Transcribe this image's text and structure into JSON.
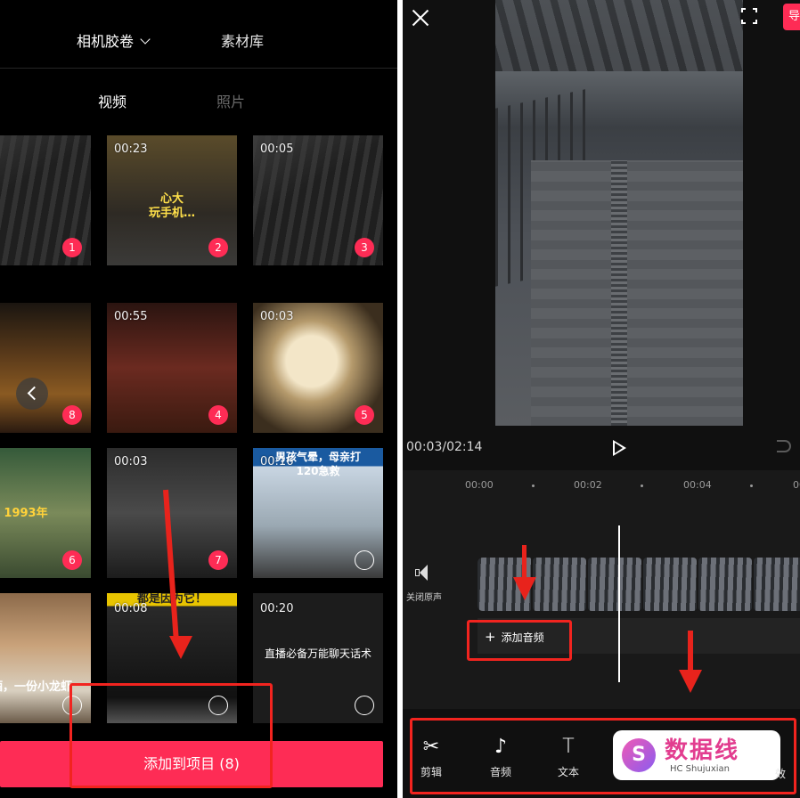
{
  "left": {
    "tabs": {
      "camera_roll": "相机胶卷",
      "library": "素材库"
    },
    "subtabs": {
      "video": "视频",
      "photo": "照片"
    },
    "cells": [
      {
        "duration": "",
        "badge": "1",
        "caption": ""
      },
      {
        "duration": "00:23",
        "badge": "2",
        "caption": "心大\n玩手机…"
      },
      {
        "duration": "00:05",
        "badge": "3",
        "caption": ""
      },
      {
        "duration": "",
        "badge": "8",
        "caption": ""
      },
      {
        "duration": "00:55",
        "badge": "4",
        "caption": ""
      },
      {
        "duration": "00:03",
        "badge": "5",
        "caption": ""
      },
      {
        "duration": "",
        "badge": "6",
        "caption": "1993年"
      },
      {
        "duration": "00:03",
        "badge": "7",
        "caption": ""
      },
      {
        "duration": "00:16",
        "badge": "",
        "caption": "男孩气晕，母亲打\n120急救"
      },
      {
        "duration": "",
        "badge": "",
        "caption": "啤酒，一份小龙虾"
      },
      {
        "duration": "00:08",
        "badge": "",
        "caption": "都是因为它！"
      },
      {
        "duration": "00:20",
        "badge": "",
        "caption": "直播必备万能聊天话术"
      }
    ],
    "add_button": "添加到项目 (8)"
  },
  "right": {
    "timecode": "00:03/02:14",
    "ticks": [
      "00:00",
      "00:02",
      "00:04",
      "00:0"
    ],
    "mute_label": "关闭原声",
    "add_audio": "添加音频",
    "tools": {
      "cut": "剪辑",
      "audio": "音频",
      "text": "文本",
      "more": "效"
    },
    "export_label": "导",
    "watermark": {
      "name": "数据线",
      "sub": "HC Shujuxian"
    }
  },
  "colors": {
    "accent": "#fe2c55",
    "annotation": "#f2241f"
  }
}
